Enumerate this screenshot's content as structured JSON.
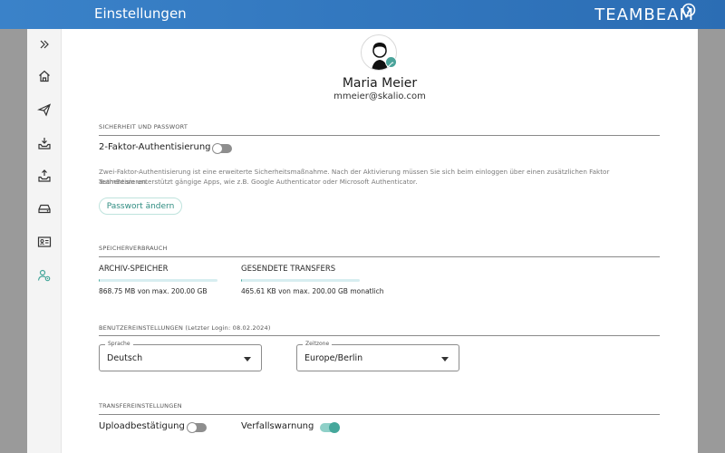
{
  "header": {
    "title": "Einstellungen",
    "brand": "TEAMBEAM"
  },
  "sidebar": {
    "items": [
      {
        "icon": "expand-icon",
        "active": false
      },
      {
        "icon": "home-icon",
        "active": false
      },
      {
        "icon": "send-icon",
        "active": false
      },
      {
        "icon": "inbox-download-icon",
        "active": false
      },
      {
        "icon": "inbox-upload-icon",
        "active": false
      },
      {
        "icon": "storage-drive-icon",
        "active": false
      },
      {
        "icon": "contact-card-icon",
        "active": false
      },
      {
        "icon": "user-settings-icon",
        "active": true
      }
    ]
  },
  "profile": {
    "name": "Maria Meier",
    "email": "mmeier@skalio.com"
  },
  "security": {
    "section_title": "SICHERHEIT UND PASSWORT",
    "two_factor_label": "2-Faktor-Authentisierung",
    "two_factor_enabled": false,
    "description_line1": "Zwei-Faktor-Authentisierung ist eine erweiterte Sicherheitsmaßnahme. Nach der Aktivierung müssen Sie sich beim einloggen über einen zusätzlichen Faktor authentisieren.",
    "description_line2": "TeamBeam unterstützt gängige Apps, wie z.B. Google Authenticator oder Microsoft Authenticator.",
    "change_password_label": "Passwort ändern"
  },
  "storage": {
    "section_title": "SPEICHERVERBRAUCH",
    "archive": {
      "title": "ARCHIV-SPEICHER",
      "usage": "868.75 MB von max. 200.00 GB",
      "fraction": 0.004
    },
    "transfers": {
      "title": "GESENDETE TRANSFERS",
      "usage": "465.61 KB von max. 200.00 GB monatlich",
      "fraction": 0.002
    }
  },
  "user_settings": {
    "section_title": "BENUTZEREINSTELLUNGEN (Letzter Login: 08.02.2024)",
    "language": {
      "label": "Sprache",
      "value": "Deutsch"
    },
    "timezone": {
      "label": "Zeitzone",
      "value": "Europe/Berlin"
    }
  },
  "transfer_settings": {
    "section_title": "TRANSFEREINSTELLUNGEN",
    "upload_confirmation": {
      "label": "Uploadbestätigung",
      "enabled": false
    },
    "expiry_warning": {
      "label": "Verfallswarnung",
      "enabled": true
    }
  },
  "colors": {
    "header_blue": "#2b6db4",
    "accent_teal": "#45a79b"
  }
}
